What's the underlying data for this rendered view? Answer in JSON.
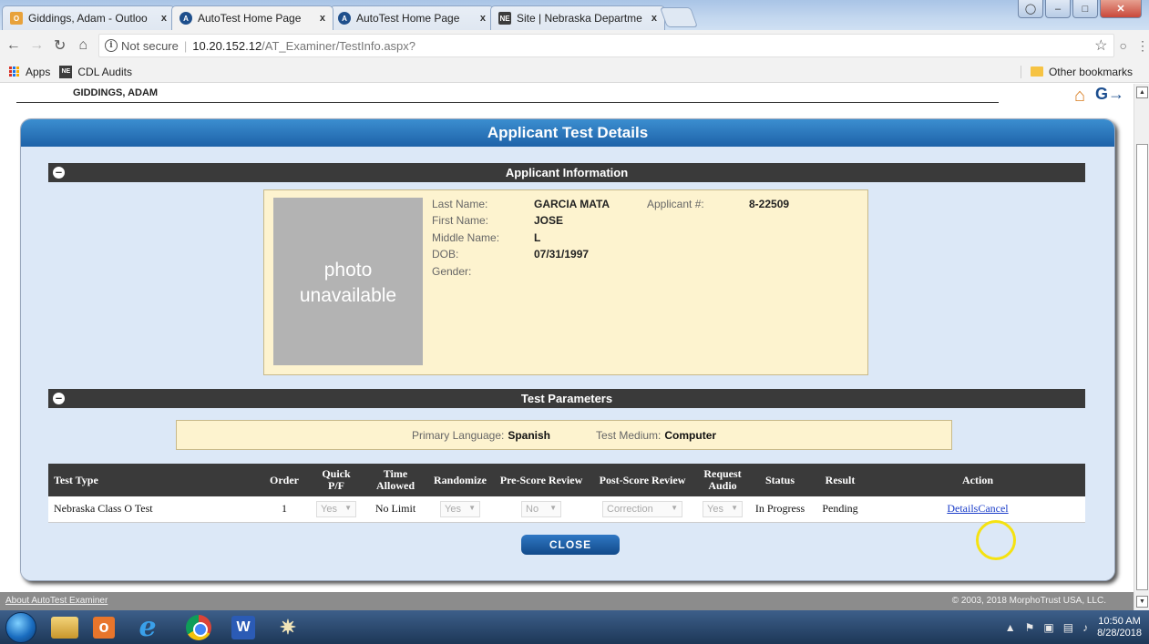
{
  "browser": {
    "tabs": [
      {
        "title": "Giddings, Adam - Outloo",
        "favicon": "outlook-icon"
      },
      {
        "title": "AutoTest Home Page",
        "favicon": "autotest-icon"
      },
      {
        "title": "AutoTest Home Page",
        "favicon": "autotest-icon"
      },
      {
        "title": "Site | Nebraska Departme",
        "favicon": "nebraska-icon"
      }
    ],
    "tab_close": "x",
    "favicon_ne": "NE",
    "favicon_outlook": "O",
    "favicon_autotest": "A",
    "security_label": "Not secure",
    "url_host": "10.20.152.12",
    "url_path": "/AT_Examiner/TestInfo.aspx?",
    "bookmarks": {
      "apps": "Apps",
      "cdl": "CDL Audits",
      "other": "Other bookmarks"
    }
  },
  "page": {
    "user_name": "GIDDINGS, ADAM",
    "panel_title": "Applicant Test Details",
    "applicant_section_title": "Applicant Information",
    "photo_text_line1": "photo",
    "photo_text_line2": "unavailable",
    "applicant": {
      "last_name_label": "Last Name:",
      "last_name": "GARCIA MATA",
      "first_name_label": "First Name:",
      "first_name": "JOSE",
      "middle_name_label": "Middle Name:",
      "middle_name": "L",
      "dob_label": "DOB:",
      "dob": "07/31/1997",
      "gender_label": "Gender:",
      "gender": "",
      "applicant_num_label": "Applicant #:",
      "applicant_num": "8-22509"
    },
    "params_section_title": "Test Parameters",
    "params": {
      "language_label": "Primary Language:",
      "language": "Spanish",
      "medium_label": "Test Medium:",
      "medium": "Computer"
    },
    "table": {
      "headers": {
        "test_type": "Test Type",
        "order": "Order",
        "quick_pf": "Quick P/F",
        "time_allowed": "Time Allowed",
        "randomize": "Randomize",
        "pre_score": "Pre-Score Review",
        "post_score": "Post-Score Review",
        "request_audio": "Request Audio",
        "status": "Status",
        "result": "Result",
        "action": "Action"
      },
      "row": {
        "test_type": "Nebraska Class O Test",
        "order": "1",
        "quick_pf": "Yes",
        "time_allowed": "No Limit",
        "randomize": "Yes",
        "pre_score": "No",
        "post_score": "Correction",
        "request_audio": "Yes",
        "status": "In Progress",
        "result": "Pending",
        "action_details": "Details",
        "action_cancel": "Cancel"
      }
    },
    "close_button": "CLOSE",
    "footer_about": "About AutoTest Examiner",
    "footer_copyright": "© 2003, 2018 MorphoTrust USA, LLC."
  },
  "taskbar": {
    "time": "10:50 AM",
    "date": "8/28/2018",
    "word_label": "W"
  }
}
